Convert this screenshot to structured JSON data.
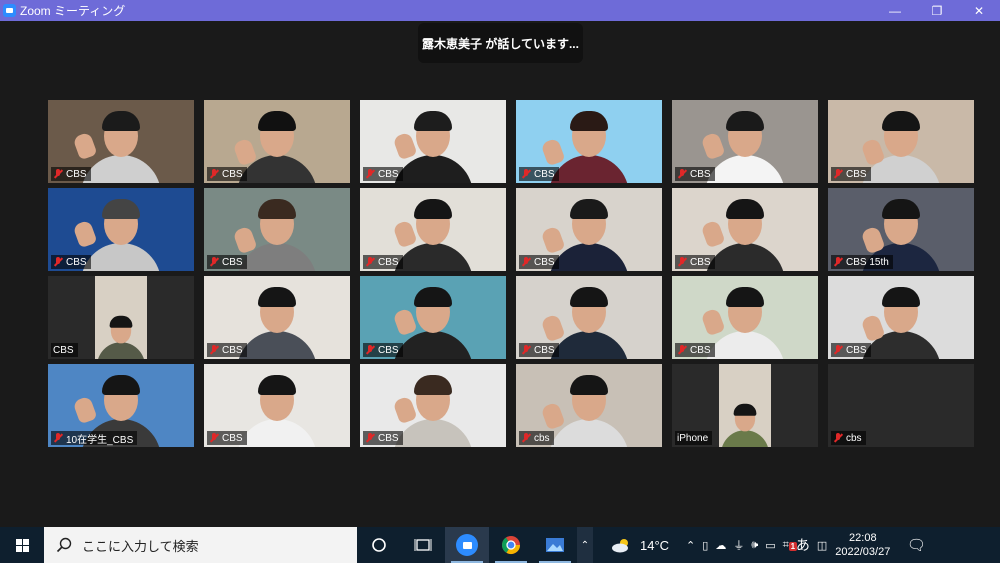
{
  "window": {
    "title": "Zoom ミーティング",
    "minimize_glyph": "—",
    "restore_glyph": "❐",
    "close_glyph": "✕"
  },
  "speaker_banner": "露木恵美子 が話しています...",
  "tiles": [
    {
      "label": "CBS",
      "muted": true,
      "bg": "#6b5a4a",
      "shirt": "#cfcfcf",
      "hair": "#1b1b1b",
      "hand": true
    },
    {
      "label": "CBS",
      "muted": true,
      "bg": "#b8a890",
      "shirt": "#333333",
      "hair": "#111111",
      "hand": true
    },
    {
      "label": "CBS",
      "muted": true,
      "bg": "#e8e8e6",
      "shirt": "#1e1e1e",
      "hair": "#1d1d1d",
      "hand": true
    },
    {
      "label": "CBS",
      "muted": true,
      "bg": "#8fd0f0",
      "shirt": "#6a2430",
      "hair": "#2a1a15",
      "hand": true
    },
    {
      "label": "CBS",
      "muted": true,
      "bg": "#9a9590",
      "shirt": "#f4f4f4",
      "hair": "#1a1a1a",
      "hand": true
    },
    {
      "label": "CBS",
      "muted": true,
      "bg": "#c9b9a8",
      "shirt": "#d0d0d0",
      "hair": "#151515",
      "hand": true
    },
    {
      "label": "CBS",
      "muted": true,
      "bg": "#1e4b92",
      "shirt": "#c7c7c7",
      "hair": "#444444",
      "hand": true
    },
    {
      "label": "CBS",
      "muted": true,
      "bg": "#7a8a85",
      "shirt": "#7e7e7e",
      "hair": "#3a2a20",
      "hand": true
    },
    {
      "label": "CBS",
      "muted": true,
      "bg": "#e2dfd8",
      "shirt": "#2a2a2a",
      "hair": "#151515",
      "hand": true
    },
    {
      "label": "CBS",
      "muted": true,
      "bg": "#d8d3cc",
      "shirt": "#1b2238",
      "hair": "#1a1a1a",
      "hand": true
    },
    {
      "label": "CBS",
      "muted": true,
      "bg": "#dcd5cc",
      "shirt": "#2b2b2b",
      "hair": "#151515",
      "hand": true
    },
    {
      "label": "CBS 15th",
      "muted": true,
      "bg": "#5a5e6a",
      "shirt": "#1c2640",
      "hair": "#151515",
      "hand": true
    },
    {
      "label": "CBS",
      "muted": false,
      "bg": "#2a2a2a",
      "shirt": "#555a48",
      "hair": "#151515",
      "hand": true,
      "inset": true
    },
    {
      "label": "CBS",
      "muted": true,
      "bg": "#e6e2dc",
      "shirt": "#4a4f58",
      "hair": "#151515",
      "hand": false
    },
    {
      "label": "CBS",
      "muted": true,
      "bg": "#5aa2b4",
      "shirt": "#222222",
      "hair": "#151515",
      "hand": true
    },
    {
      "label": "CBS",
      "muted": true,
      "bg": "#d6d2cc",
      "shirt": "#1f2a3a",
      "hair": "#151515",
      "hand": true
    },
    {
      "label": "CBS",
      "muted": true,
      "bg": "#cfd8c8",
      "shirt": "#ececec",
      "hair": "#151515",
      "hand": true
    },
    {
      "label": "CBS",
      "muted": true,
      "bg": "#dcdcdc",
      "shirt": "#2d2d2d",
      "hair": "#151515",
      "hand": true
    },
    {
      "label": "10在学生_CBS",
      "muted": true,
      "bg": "#4e86c4",
      "shirt": "#3a3a3a",
      "hair": "#151515",
      "hand": true
    },
    {
      "label": "CBS",
      "muted": true,
      "bg": "#e8e6e2",
      "shirt": "#f1f1f1",
      "hair": "#151515",
      "hand": false
    },
    {
      "label": "CBS",
      "muted": true,
      "bg": "#e9e9e9",
      "shirt": "#c7c3bc",
      "hair": "#3a2a20",
      "hand": true
    },
    {
      "label": "cbs",
      "muted": true,
      "bg": "#c8c0b6",
      "shirt": "#dcdcdc",
      "hair": "#151515",
      "hand": true
    },
    {
      "label": "iPhone",
      "muted": false,
      "bg": "#2a2a2a",
      "shirt": "#6a7a4a",
      "hair": "#151515",
      "hand": false,
      "inset": true
    },
    {
      "label": "cbs",
      "muted": true,
      "bg": "#2a2a2a",
      "empty": true
    }
  ],
  "taskbar": {
    "search_placeholder": "ここに入力して検索",
    "weather": "14°C",
    "ime": "あ",
    "time": "22:08",
    "date": "2022/03/27",
    "notification_badge": "1"
  }
}
